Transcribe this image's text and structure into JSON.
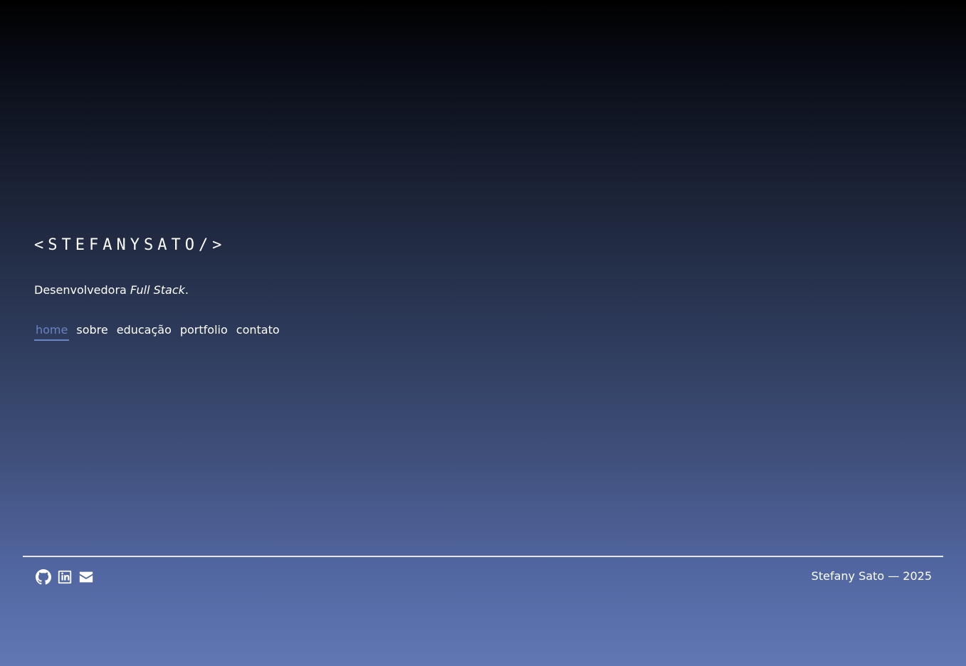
{
  "header": {
    "logo": "<STEFANYSATO/>",
    "tagline_prefix": "Desenvolvedora ",
    "tagline_emphasis": "Full Stack",
    "tagline_suffix": "."
  },
  "nav": {
    "items": [
      {
        "label": "home",
        "active": true
      },
      {
        "label": "sobre",
        "active": false
      },
      {
        "label": "educação",
        "active": false
      },
      {
        "label": "portfolio",
        "active": false
      },
      {
        "label": "contato",
        "active": false
      }
    ],
    "active_color": "#6b82c4"
  },
  "footer": {
    "social_icons": [
      "github-icon",
      "linkedin-icon",
      "email-icon"
    ],
    "copyright": "Stefany Sato — 2025"
  }
}
